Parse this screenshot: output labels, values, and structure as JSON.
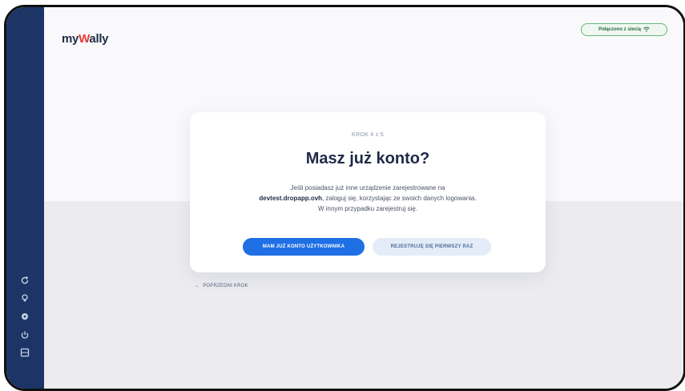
{
  "app": {
    "logo_prefix": "my",
    "logo_w": "W",
    "logo_suffix": "ally"
  },
  "network": {
    "label": "Połączono z siecią",
    "icon": "wifi-icon",
    "color": "#64b87a"
  },
  "card": {
    "step": "KROK 4 z 5",
    "title": "Masz już konto?",
    "desc_line1": "Jeśli posiadasz już inne urządzenie zarejestrowane na",
    "desc_domain": "devtest.dropapp.ovh",
    "desc_line2": ", zaloguj się, korzystając ze swoich danych logowania.",
    "desc_line3": "W innym przypadku zarejestruj się.",
    "primary_button": "MAM JUŻ KONTO UŻYTKOWNIKA",
    "secondary_button": "REJESTRUJĘ SIĘ PIERWSZY RAZ"
  },
  "back_link": {
    "arrow": "←",
    "label": "POPRZEDNI KROK"
  },
  "sidebar": {
    "icons": [
      "refresh-icon",
      "bulb-icon",
      "settings-icon",
      "power-icon",
      "grid-icon"
    ],
    "color": "#1d3566"
  },
  "colors": {
    "primary": "#1f6fe5",
    "title": "#1e2a46"
  }
}
